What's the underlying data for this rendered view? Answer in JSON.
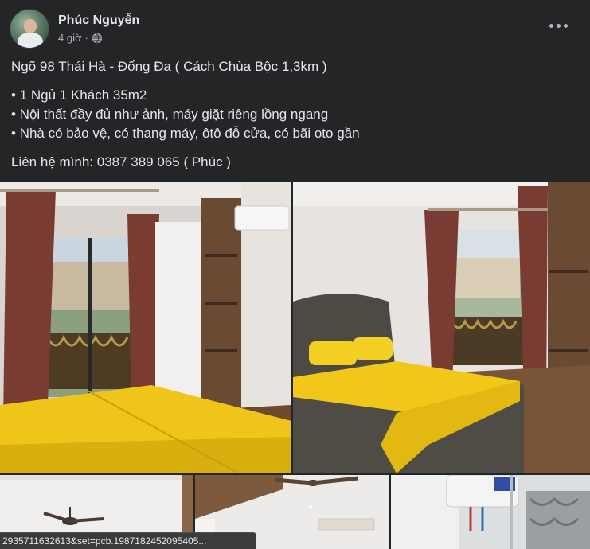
{
  "post": {
    "author": "Phúc Nguyễn",
    "time": "4 giờ",
    "separator": "·",
    "privacy_icon": "globe-icon",
    "more_icon": "more-options-icon",
    "lines": {
      "address": "Ngõ 98 Thái Hà - Đống Đa ( Cách Chùa Bộc 1,3km )",
      "bullet1": "• 1 Ngủ 1 Khách 35m2",
      "bullet2": "• Nội thất đầy đủ như ảnh, máy giặt riêng lồng ngang",
      "bullet3": "• Nhà có bảo vệ, có thang máy, ôtô đỗ cửa, có bãi oto gần",
      "contact": "Liên hệ mình: 0387 389 065 ( Phúc )"
    }
  },
  "status_url": "2935711632613&set=pcb.1987182452095405...",
  "colors": {
    "background": "#242526",
    "text": "#e4e6eb",
    "secondary_text": "#b0b3b8"
  }
}
